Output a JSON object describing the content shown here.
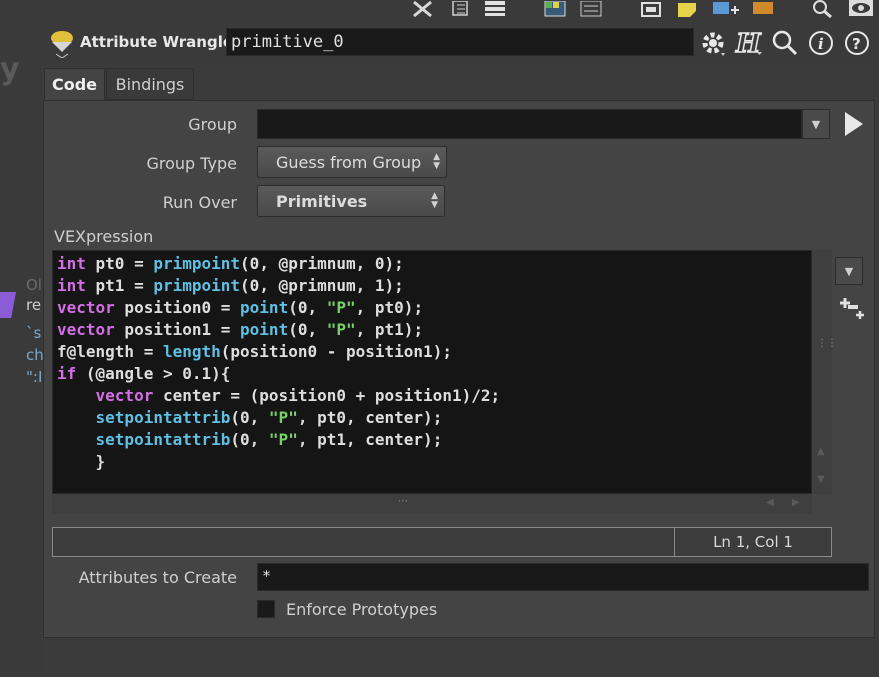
{
  "left_strip": {
    "fragment_y": "y",
    "fragment_of": "Ol",
    "fragment_re": "re",
    "fragment_s": "`s",
    "fragment_ch": "ch",
    "fragment_q": "\":I"
  },
  "header": {
    "node_type": "Attribute Wrangle",
    "node_name": "primitive_0"
  },
  "tabs": [
    {
      "label": "Code",
      "active": true
    },
    {
      "label": "Bindings",
      "active": false
    }
  ],
  "params": {
    "group_label": "Group",
    "group_value": "",
    "group_type_label": "Group Type",
    "group_type_value": "Guess from Group",
    "run_over_label": "Run Over",
    "run_over_value": "Primitives",
    "vexpression_label": "VEXpression",
    "attributes_to_create_label": "Attributes to Create",
    "attributes_to_create_value": "*",
    "enforce_prototypes_label": "Enforce Prototypes",
    "enforce_prototypes_checked": false
  },
  "code": {
    "lines": [
      [
        {
          "t": "kw",
          "v": "int"
        },
        {
          "t": "",
          "v": " pt0 = "
        },
        {
          "t": "fn",
          "v": "primpoint"
        },
        {
          "t": "",
          "v": "(0, @primnum, 0);"
        }
      ],
      [
        {
          "t": "kw",
          "v": "int"
        },
        {
          "t": "",
          "v": " pt1 = "
        },
        {
          "t": "fn",
          "v": "primpoint"
        },
        {
          "t": "",
          "v": "(0, @primnum, 1);"
        }
      ],
      [
        {
          "t": "kw",
          "v": "vector"
        },
        {
          "t": "",
          "v": " position0 = "
        },
        {
          "t": "fn",
          "v": "point"
        },
        {
          "t": "",
          "v": "(0, "
        },
        {
          "t": "str",
          "v": "\"P\""
        },
        {
          "t": "",
          "v": ", pt0);"
        }
      ],
      [
        {
          "t": "kw",
          "v": "vector"
        },
        {
          "t": "",
          "v": " position1 = "
        },
        {
          "t": "fn",
          "v": "point"
        },
        {
          "t": "",
          "v": "(0, "
        },
        {
          "t": "str",
          "v": "\"P\""
        },
        {
          "t": "",
          "v": ", pt1);"
        }
      ],
      [
        {
          "t": "",
          "v": "f@length = "
        },
        {
          "t": "fn",
          "v": "length"
        },
        {
          "t": "",
          "v": "(position0 - position1);"
        }
      ],
      [
        {
          "t": "kw",
          "v": "if"
        },
        {
          "t": "",
          "v": " (@angle > 0.1){"
        }
      ],
      [
        {
          "t": "",
          "v": "    "
        },
        {
          "t": "kw",
          "v": "vector"
        },
        {
          "t": "",
          "v": " center = (position0 + position1)/2;"
        }
      ],
      [
        {
          "t": "",
          "v": "    "
        },
        {
          "t": "fn",
          "v": "setpointattrib"
        },
        {
          "t": "",
          "v": "(0, "
        },
        {
          "t": "str",
          "v": "\"P\""
        },
        {
          "t": "",
          "v": ", pt0, center);"
        }
      ],
      [
        {
          "t": "",
          "v": "    "
        },
        {
          "t": "fn",
          "v": "setpointattrib"
        },
        {
          "t": "",
          "v": "(0, "
        },
        {
          "t": "str",
          "v": "\"P\""
        },
        {
          "t": "",
          "v": ", pt1, center);"
        }
      ],
      [
        {
          "t": "",
          "v": "    }"
        }
      ]
    ],
    "cursor_position": "Ln 1, Col 1"
  },
  "colors": {
    "keyword": "#d36ee6",
    "function": "#5fc0e4",
    "string": "#7ad16a",
    "panel_bg": "#444444",
    "editor_bg": "#151515"
  }
}
